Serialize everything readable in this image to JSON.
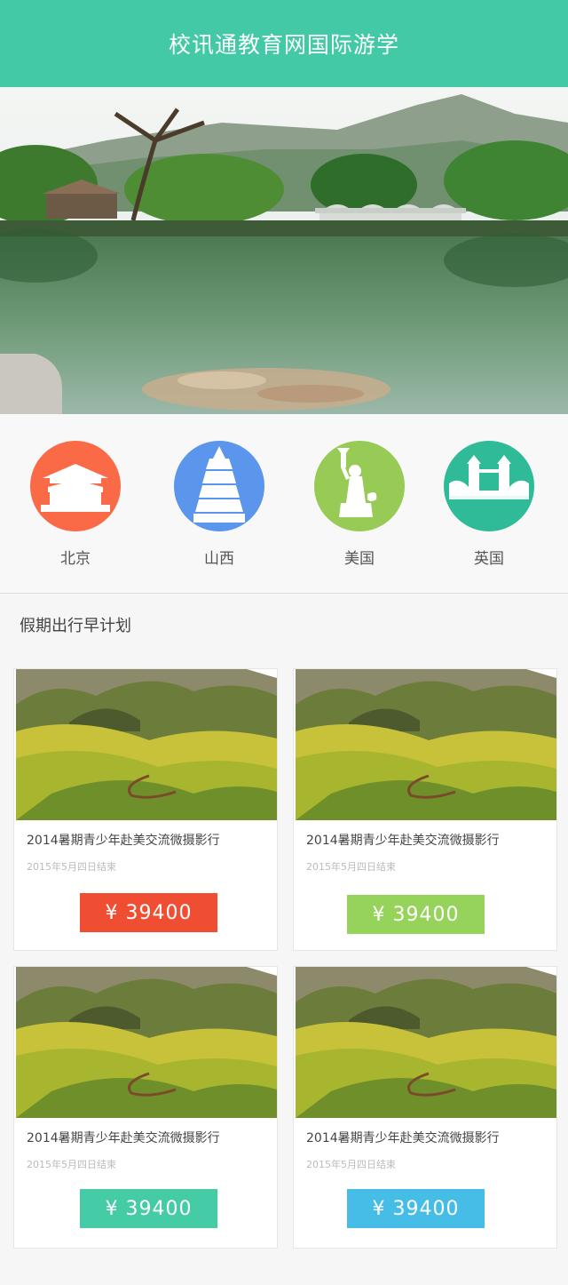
{
  "header": {
    "title": "校讯通教育网国际游学"
  },
  "destinations": [
    {
      "label": "北京",
      "icon": "palace-icon",
      "color": "#fb6a47"
    },
    {
      "label": "山西",
      "icon": "pagoda-icon",
      "color": "#5b95ec"
    },
    {
      "label": "美国",
      "icon": "statue-of-liberty-icon",
      "color": "#97cb55"
    },
    {
      "label": "英国",
      "icon": "tower-bridge-icon",
      "color": "#2fbb97"
    }
  ],
  "section": {
    "title": "假期出行早计划"
  },
  "cards": [
    {
      "title": "2014暑期青少年赴美交流微摄影行",
      "date": "2015年5月四日结束",
      "price": "¥ 39400",
      "color": "#f04e33"
    },
    {
      "title": "2014暑期青少年赴美交流微摄影行",
      "date": "2015年5月四日结束",
      "price": "¥ 39400",
      "color": "#96d35b"
    },
    {
      "title": "2014暑期青少年赴美交流微摄影行",
      "date": "2015年5月四日结束",
      "price": "¥ 39400",
      "color": "#45cba5"
    },
    {
      "title": "2014暑期青少年赴美交流微摄影行",
      "date": "2015年5月四日结束",
      "price": "¥ 39400",
      "color": "#46bde6"
    }
  ]
}
